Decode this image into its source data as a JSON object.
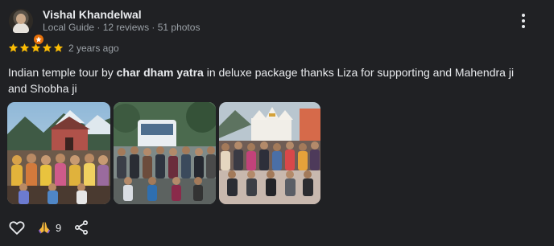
{
  "reviewer": {
    "name": "Vishal Khandelwal",
    "meta": "Local Guide · 12 reviews · 51 photos",
    "avatar_icon": "profile-avatar",
    "badge_icon": "local-guide-badge-icon"
  },
  "review": {
    "rating": 5,
    "max_rating": 5,
    "date": "2 years ago",
    "text_before": "Indian temple tour by ",
    "text_bold": "char dham yatra",
    "text_after": " in deluxe package thanks Liza for supporting and Mahendra ji and Shobha ji"
  },
  "photos": [
    {
      "icon": "temple-group-photo"
    },
    {
      "icon": "bus-group-photo"
    },
    {
      "icon": "temple-crowd-photo"
    }
  ],
  "actions": {
    "like_icon": "heart-outline-icon",
    "thanks_icon": "folded-hands-icon",
    "thanks_count": "9",
    "share_icon": "share-icon",
    "more_icon": "more-vertical-icon"
  },
  "colors": {
    "background": "#202124",
    "star": "#fbbc04",
    "text": "#e8eaed",
    "secondary_text": "#9aa0a6",
    "guide_badge": "#e8710a"
  }
}
